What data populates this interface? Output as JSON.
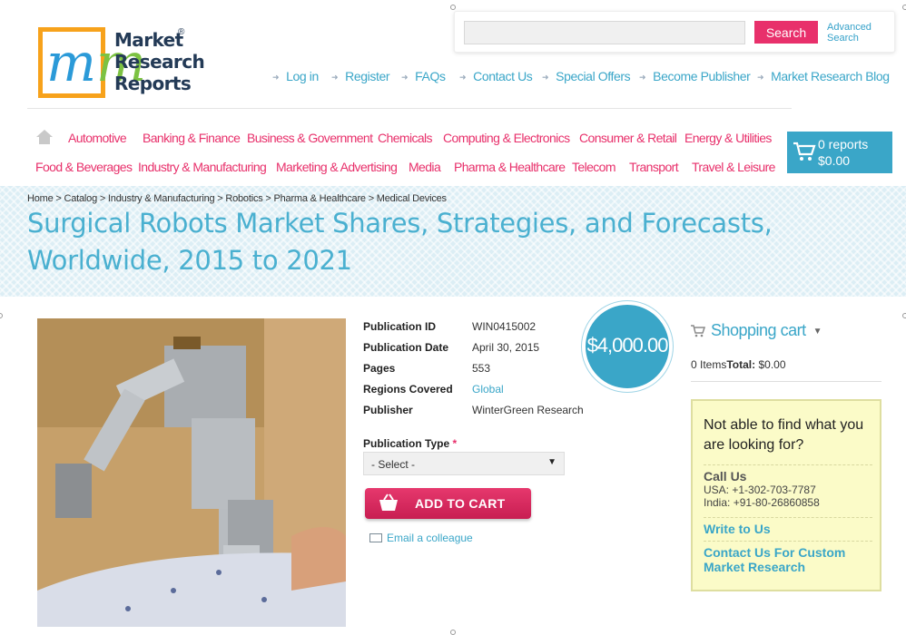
{
  "logo": {
    "line1": "Market",
    "line2": "Research",
    "line3": "Reports",
    "reg": "®"
  },
  "search": {
    "placeholder": "",
    "button": "Search",
    "advanced_line1": "Advanced",
    "advanced_line2": "Search"
  },
  "topnav": [
    "Log in",
    "Register",
    "FAQs",
    "Contact Us",
    "Special Offers",
    "Become Publisher",
    "Market Research Blog"
  ],
  "categories_row1": [
    "Automotive",
    "Banking & Finance",
    "Business & Government",
    "Chemicals",
    "Computing & Electronics",
    "Consumer & Retail",
    "Energy & Utilities"
  ],
  "categories_row2": [
    "Food & Beverages",
    "Industry & Manufacturing",
    "Marketing & Advertising",
    "Media",
    "Pharma & Healthcare",
    "Telecom",
    "Transport",
    "Travel & Leisure"
  ],
  "header_cart": {
    "reports": "0 reports",
    "total": "$0.00"
  },
  "breadcrumb": "Home > Catalog > Industry & Manufacturing > Robotics > Pharma & Healthcare > Medical Devices",
  "title": "Surgical Robots Market Shares, Strategies, and Forecasts, Worldwide, 2015 to 2021",
  "details": [
    {
      "label": "Publication ID",
      "value": "WIN0415002"
    },
    {
      "label": "Publication Date",
      "value": "April 30, 2015"
    },
    {
      "label": "Pages",
      "value": "553"
    },
    {
      "label": "Regions Covered",
      "value": "Global"
    },
    {
      "label": "Publisher",
      "value": "WinterGreen Research"
    }
  ],
  "price": "$4,000.00",
  "publication_type": {
    "label": "Publication Type",
    "required_mark": "*",
    "selected": "- Select -"
  },
  "add_to_cart": "ADD TO CART",
  "email_colleague": "Email a colleague",
  "shopping_cart": {
    "title": "Shopping cart",
    "items": "0 Items",
    "total_label": "Total:",
    "total": "$0.00"
  },
  "help": {
    "title": "Not able to find what you are looking for?",
    "call_us": "Call Us",
    "usa": "USA: +1-302-703-7787",
    "india": "India: +91-80-26860858",
    "write": "Write to Us",
    "custom": "Contact Us For Custom Market Research"
  },
  "colors": {
    "brand_pink": "#e8306b",
    "brand_blue": "#3aa6c8",
    "logo_orange": "#f7a21b"
  }
}
